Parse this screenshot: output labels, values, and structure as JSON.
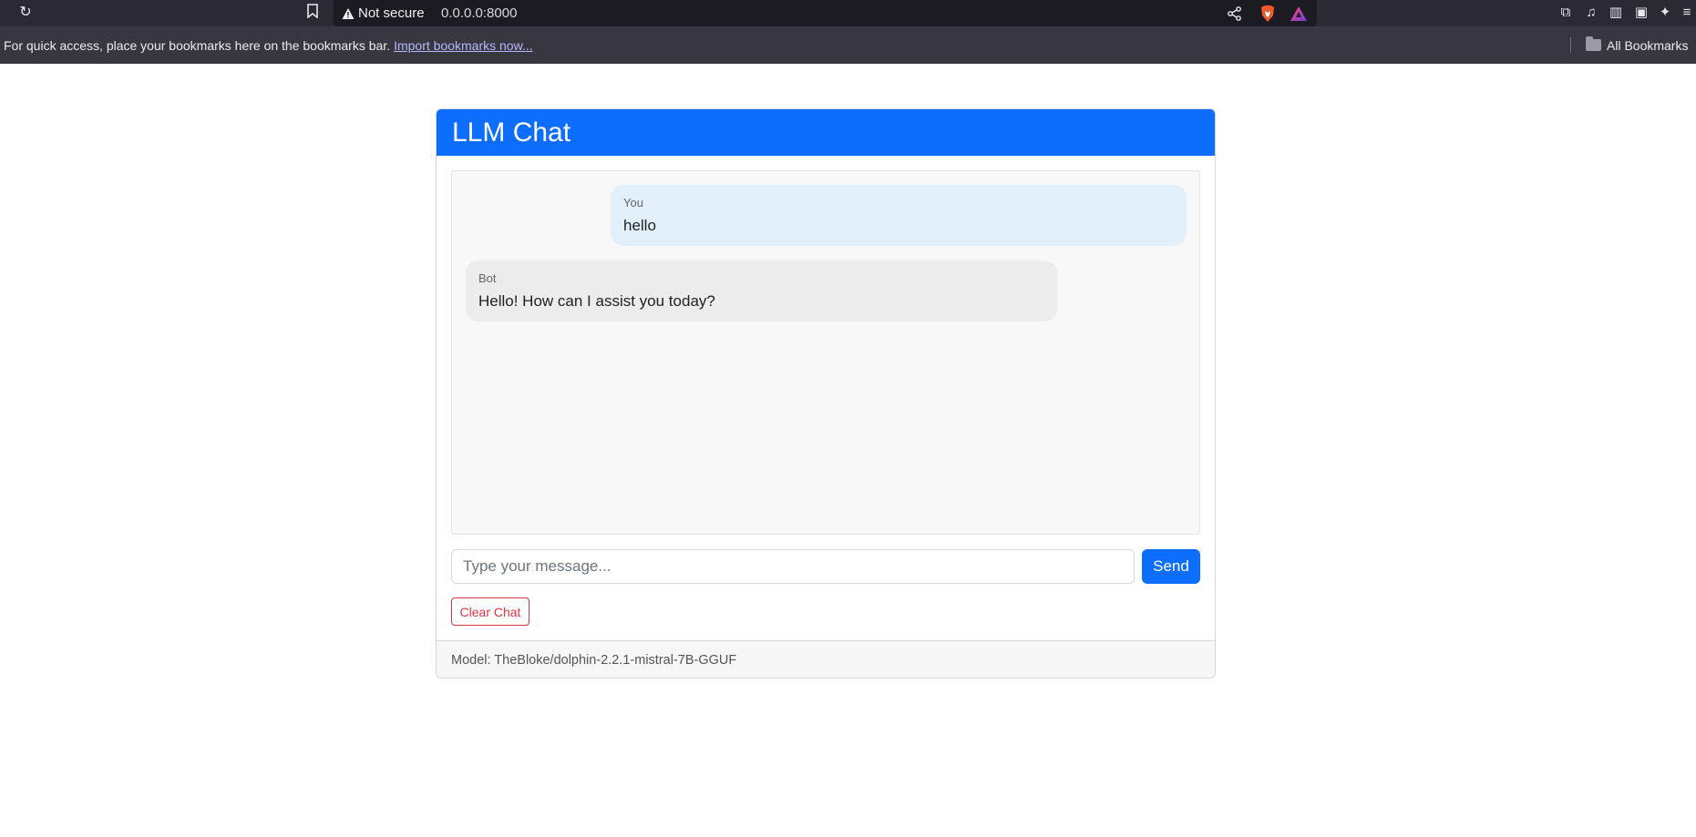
{
  "browser": {
    "security_label": "Not secure",
    "url": "0.0.0.0:8000",
    "bookmarks_hint": "For quick access, place your bookmarks here on the bookmarks bar.",
    "import_link": "Import bookmarks now...",
    "all_bookmarks": "All Bookmarks"
  },
  "chat": {
    "title": "LLM Chat",
    "messages": [
      {
        "sender": "You",
        "text": "hello"
      },
      {
        "sender": "Bot",
        "text": "Hello! How can I assist you today?"
      }
    ],
    "input_placeholder": "Type your message...",
    "send_label": "Send",
    "clear_label": "Clear Chat",
    "footer": "Model: TheBloke/dolphin-2.2.1-mistral-7B-GGUF"
  },
  "colors": {
    "primary": "#0d6efd",
    "danger": "#dc3545",
    "user_bubble": "#e2f0fc",
    "bot_bubble": "#ececec"
  }
}
